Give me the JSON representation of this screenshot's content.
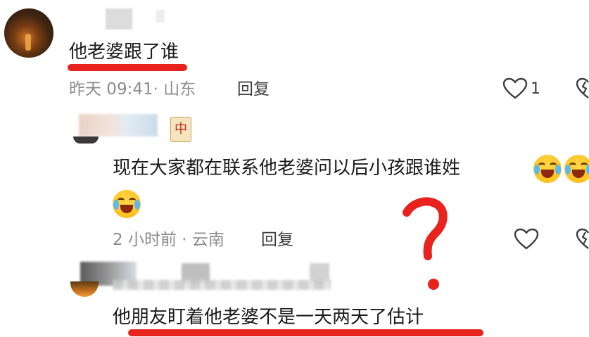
{
  "colors": {
    "highlight_red": "#e8231e",
    "meta_grey": "#8c8c8c",
    "text_dark": "#1a1a1a"
  },
  "comments": [
    {
      "text": "他老婆跟了谁",
      "meta": "昨天 09:41· 山东",
      "reply_label": "回复",
      "likes": "1"
    },
    {
      "tile_glyph": "中",
      "text": "现在大家都在联系他老婆问以后小孩跟谁姓",
      "meta": "2 小时前 · 云南",
      "reply_label": "回复"
    },
    {
      "text": "他朋友盯着他老婆不是一天两天了估计"
    }
  ],
  "icons": {
    "like": "heart-icon",
    "emoji": "laughing-crying-emoji",
    "tile": "mahjong-tile-icon"
  }
}
